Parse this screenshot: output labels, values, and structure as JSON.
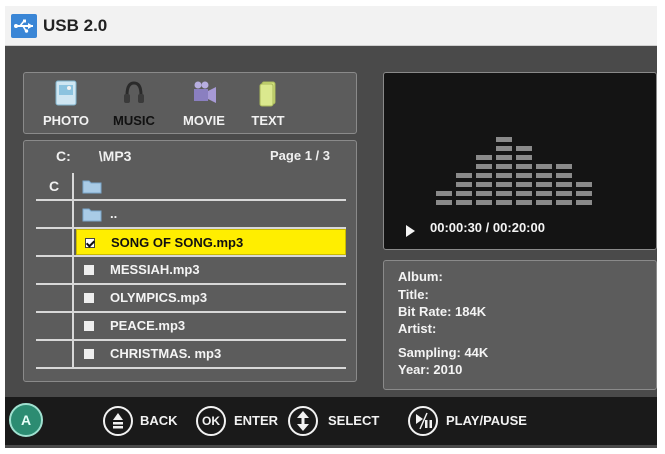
{
  "header": {
    "title": "USB 2.0",
    "icon": "usb-icon",
    "accent": "#3a86d6"
  },
  "media_tabs": [
    {
      "label": "PHOTO",
      "icon": "photo-icon",
      "active": false
    },
    {
      "label": "MUSIC",
      "icon": "music-icon",
      "active": true
    },
    {
      "label": "MOVIE",
      "icon": "movie-icon",
      "active": false
    },
    {
      "label": "TEXT",
      "icon": "text-icon",
      "active": false
    }
  ],
  "browser": {
    "drive": "C:",
    "folder": "\\MP3",
    "page": "Page 1 / 3",
    "rows": [
      {
        "gutter": "C",
        "type": "folder",
        "name": ""
      },
      {
        "gutter": "",
        "type": "folder",
        "name": ".."
      },
      {
        "gutter": "",
        "type": "file",
        "name": "SONG OF SONG.mp3",
        "selected": true
      },
      {
        "gutter": "",
        "type": "file",
        "name": "MESSIAH.mp3",
        "selected": false
      },
      {
        "gutter": "",
        "type": "file",
        "name": "OLYMPICS.mp3",
        "selected": false
      },
      {
        "gutter": "",
        "type": "file",
        "name": "PEACE.mp3",
        "selected": false
      },
      {
        "gutter": "",
        "type": "file",
        "name": "CHRISTMAS. mp3",
        "selected": false
      }
    ],
    "highlight_color": "#ffee00"
  },
  "player": {
    "elapsed": "00:00:30",
    "separator": "/",
    "total": "00:20:00",
    "equalizer_levels": [
      2,
      4,
      6,
      8,
      7,
      5,
      5,
      3
    ]
  },
  "info": {
    "album": "Album:",
    "title": "Title:",
    "bitrate": "Bit Rate:  184K",
    "artist": "Artist:",
    "sampling": "Sampling: 44K",
    "year": "Year: 2010"
  },
  "footer": {
    "logo_icon": "brand-logo-icon",
    "back": "BACK",
    "ok_key": "OK",
    "enter": "ENTER",
    "select": "SELECT",
    "playpause": "PLAY/PAUSE"
  }
}
